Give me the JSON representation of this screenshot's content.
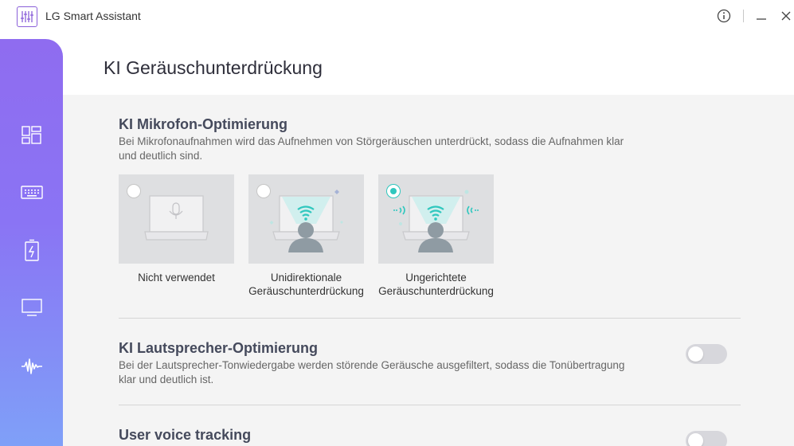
{
  "titlebar": {
    "app_title": "LG Smart Assistant",
    "icons": [
      "sliders-icon",
      "info-icon",
      "minimize-icon",
      "close-icon"
    ]
  },
  "sidebar": {
    "items": [
      {
        "id": "dashboard",
        "icon": "dashboard-grid-icon",
        "active": false
      },
      {
        "id": "keyboard",
        "icon": "keyboard-icon",
        "active": false
      },
      {
        "id": "battery",
        "icon": "battery-icon",
        "active": false
      },
      {
        "id": "display",
        "icon": "monitor-icon",
        "active": false
      },
      {
        "id": "sound",
        "icon": "sound-wave-icon",
        "active": true
      }
    ]
  },
  "page": {
    "title": "KI Geräuschunterdrückung"
  },
  "mic_section": {
    "title": "KI Mikrofon-Optimierung",
    "description_line1": "Bei Mikrofonaufnahmen wird das Aufnehmen von Störgeräuschen unterdrückt, sodass die Aufnahmen klar",
    "description_line2": "und deutlich sind.",
    "options": [
      {
        "line1": "Nicht verwendet",
        "line2": "",
        "selected": false
      },
      {
        "line1": "Unidirektionale",
        "line2": "Geräuschunterdrückung",
        "selected": false
      },
      {
        "line1": "Ungerichtete",
        "line2": "Geräuschunterdrückung",
        "selected": true
      }
    ]
  },
  "speaker_section": {
    "title": "KI Lautsprecher-Optimierung",
    "description_line1": "Bei der Lautsprecher-Tonwiedergabe werden störende Geräusche ausgefiltert, sodass die Tonübertragung",
    "description_line2": "klar und deutlich ist.",
    "enabled": false
  },
  "voice_section": {
    "title": "User voice tracking",
    "enabled": false
  },
  "colors": {
    "accent": "#2fc7be",
    "sidebar_top": "#8f6cf0",
    "sidebar_bottom": "#7fa0f8",
    "panel_bg": "#f4f4f4"
  }
}
